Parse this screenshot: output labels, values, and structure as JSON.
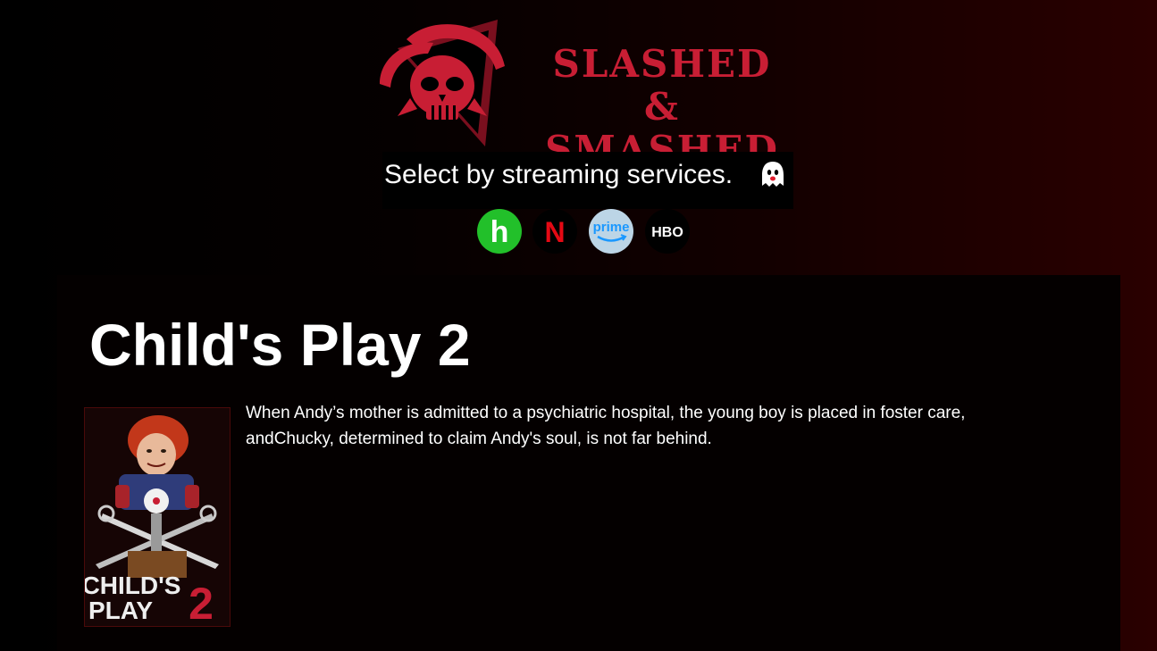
{
  "brand": {
    "line1": "SLASHED &",
    "line2": "SMASHED",
    "logo_icon": "skull-reaper-icon",
    "color": "#c81e34"
  },
  "filter": {
    "prompt": "Select by streaming services.",
    "prompt_icon": "ghost-icon",
    "services": [
      {
        "name": "hulu",
        "label": "h",
        "icon": "hulu-icon",
        "color": "#22c02a"
      },
      {
        "name": "netflix",
        "label": "N",
        "icon": "netflix-icon",
        "color": "#e50914"
      },
      {
        "name": "prime",
        "label": "prime",
        "icon": "prime-video-icon",
        "color": "#1a98ff"
      },
      {
        "name": "hbo",
        "label": "HBO",
        "icon": "hbo-icon",
        "color": "#ffffff"
      }
    ]
  },
  "movie": {
    "title": "Child's Play 2",
    "description": "When Andy’s mother is admitted to a psychiatric hospital, the young boy is placed in foster care, andChucky, determined to claim Andy's soul, is not far behind.",
    "poster_text_line1": "CHILD'S",
    "poster_text_line2": "PLAY",
    "poster_number": "2"
  }
}
